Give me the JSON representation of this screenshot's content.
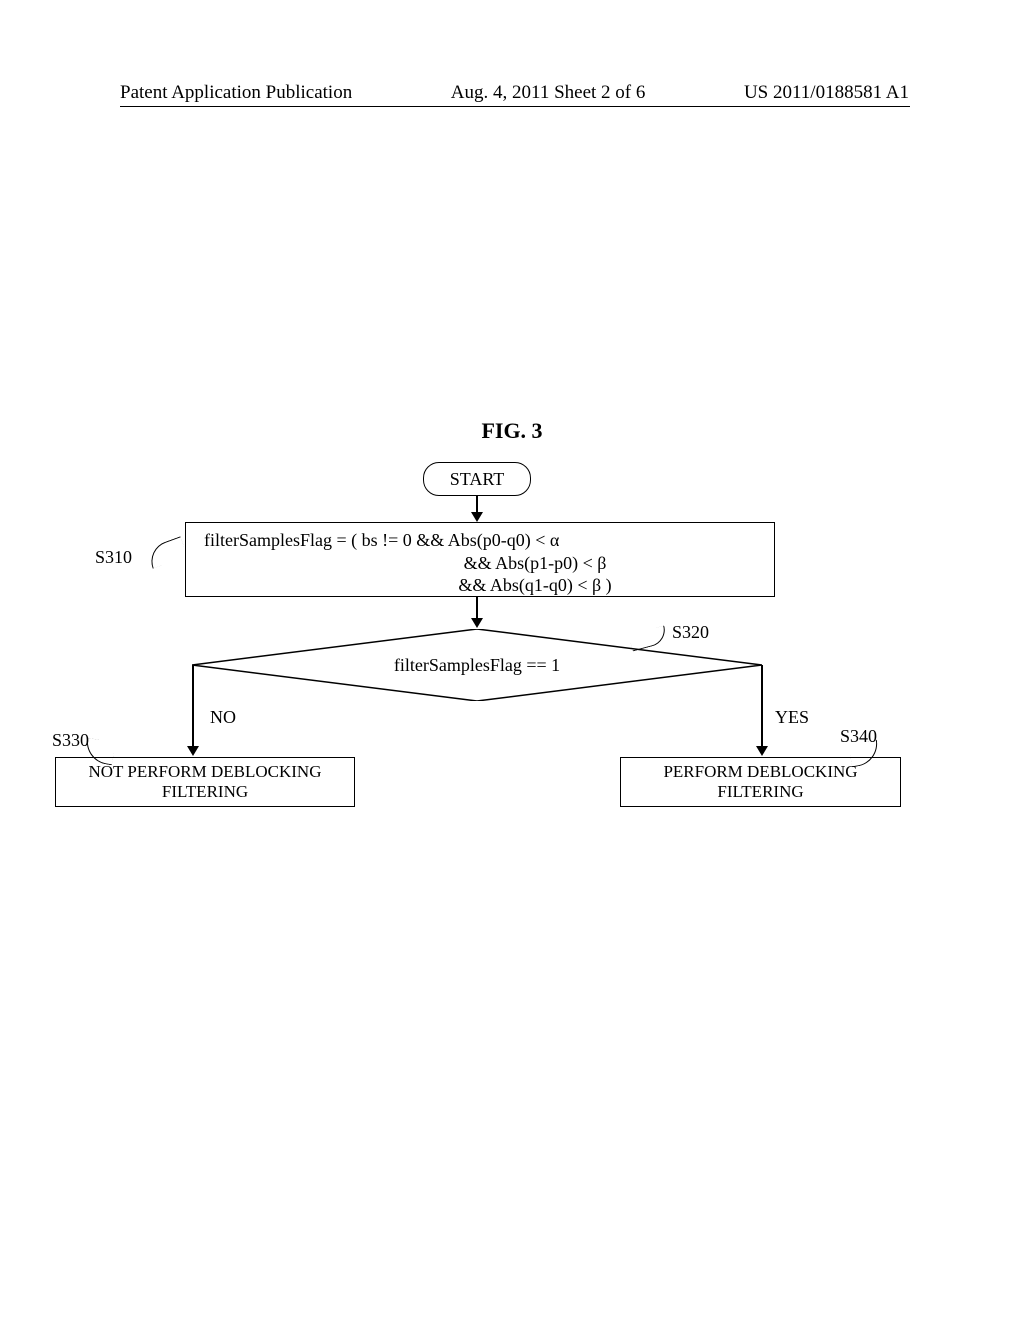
{
  "header": {
    "left": "Patent Application Publication",
    "center": "Aug. 4, 2011  Sheet 2 of 6",
    "right": "US 2011/0188581 A1"
  },
  "fig_title": "FIG. 3",
  "start": "START",
  "process_line1": "filterSamplesFlag = (  bs != 0 && Abs(p0-q0) < α",
  "process_line2": "&&  Abs(p1-p0) < β",
  "process_line3": "&&  Abs(q1-q0) < β  )",
  "decision": "filterSamplesFlag == 1",
  "labels": {
    "s310": "S310",
    "s320": "S320",
    "s330": "S330",
    "s340": "S340",
    "no": "NO",
    "yes": "YES"
  },
  "box_no": "NOT PERFORM DEBLOCKING FILTERING",
  "box_yes": "PERFORM DEBLOCKING FILTERING"
}
